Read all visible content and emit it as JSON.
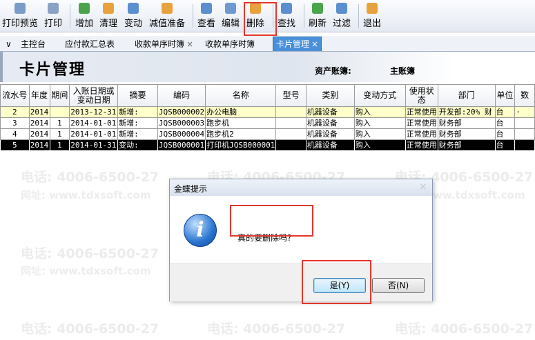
{
  "toolbar": {
    "buttons": [
      {
        "label": "打印预览",
        "icon": "print-preview-icon"
      },
      {
        "label": "打印",
        "icon": "print-icon"
      },
      {
        "label": "增加",
        "icon": "add-icon"
      },
      {
        "label": "清理",
        "icon": "clean-icon"
      },
      {
        "label": "变动",
        "icon": "change-icon"
      },
      {
        "label": "减值准备",
        "icon": "impairment-icon"
      },
      {
        "label": "查看",
        "icon": "view-icon"
      },
      {
        "label": "编辑",
        "icon": "edit-icon"
      },
      {
        "label": "删除",
        "icon": "delete-icon"
      },
      {
        "label": "查找",
        "icon": "find-icon"
      },
      {
        "label": "刷新",
        "icon": "refresh-icon"
      },
      {
        "label": "过滤",
        "icon": "filter-icon"
      },
      {
        "label": "退出",
        "icon": "exit-icon"
      }
    ]
  },
  "tabs": {
    "chevron": "∨",
    "items": [
      {
        "label": "主控台",
        "closable": false,
        "active": false
      },
      {
        "label": "应付款汇总表",
        "closable": false,
        "active": false
      },
      {
        "label": "收款单序时簿",
        "closable": true,
        "active": false
      },
      {
        "label": "收款单序时簿",
        "closable": false,
        "active": false
      },
      {
        "label": "卡片管理",
        "closable": true,
        "active": true
      }
    ],
    "close_glyph": "×"
  },
  "banner": {
    "title": "卡片管理",
    "account_label": "资产账簿:",
    "account_value": "主账簿"
  },
  "table": {
    "headers": [
      "流水号",
      "年度",
      "期间",
      "入账日期或变动日期",
      "摘要",
      "编码",
      "名称",
      "型号",
      "类别",
      "变动方式",
      "使用状态",
      "部门",
      "单位",
      "数"
    ],
    "rows": [
      [
        "2",
        "2014",
        "",
        "2013-12-31",
        "新增:",
        "JQSB000002",
        "办公电脑",
        "",
        "机器设备",
        "购入",
        "正常使用",
        "开发部:20% 财",
        "台",
        "·"
      ],
      [
        "3",
        "2014",
        "1",
        "2014-01-01",
        "新增:",
        "JQSB000003",
        "跑步机",
        "",
        "机器设备",
        "购入",
        "正常使用",
        "财务部",
        "台",
        ""
      ],
      [
        "4",
        "2014",
        "1",
        "2014-01-01",
        "新增:",
        "JQSB000004",
        "跑步机2",
        "",
        "机器设备",
        "购入",
        "正常使用",
        "财务部",
        "台",
        ""
      ],
      [
        "5",
        "2014",
        "1",
        "2014-01-31",
        "变动:",
        "JQSB000001",
        "打印机JQSB000001",
        "",
        "机器设备",
        "购入",
        "正常使用",
        "财务部",
        "台",
        ""
      ]
    ]
  },
  "watermark": {
    "phone": "电话: 4006-6500-27",
    "site": "网址: www.tdxsoft.com"
  },
  "dialog": {
    "title": "金蝶提示",
    "message": "真的要删除吗?",
    "yes_label": "是(Y)",
    "no_label": "否(N)",
    "close_glyph": "×",
    "icon": "information-icon"
  },
  "colors": {
    "highlight_box": "#e5352b",
    "active_tab": "#4a90d9",
    "selected_row": "#000000",
    "first_row": "#ffffc9"
  }
}
